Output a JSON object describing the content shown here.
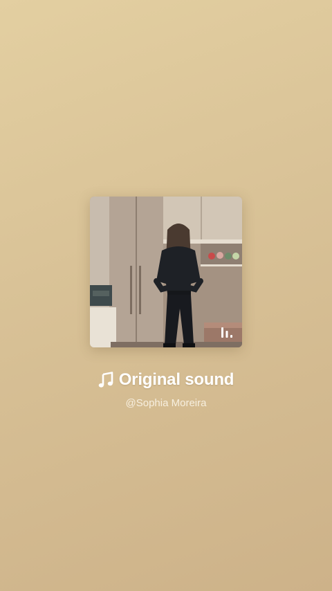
{
  "sound": {
    "title": "Original sound",
    "author": "@Sophia Moreira"
  },
  "icons": {
    "title_icon": "music-note-icon",
    "cover_badge": "audio-bars-icon"
  },
  "colors": {
    "background_top": "#e3cfa1",
    "background_bottom": "#cdb289",
    "title": "#ffffff",
    "subtitle": "#f7efdf"
  }
}
